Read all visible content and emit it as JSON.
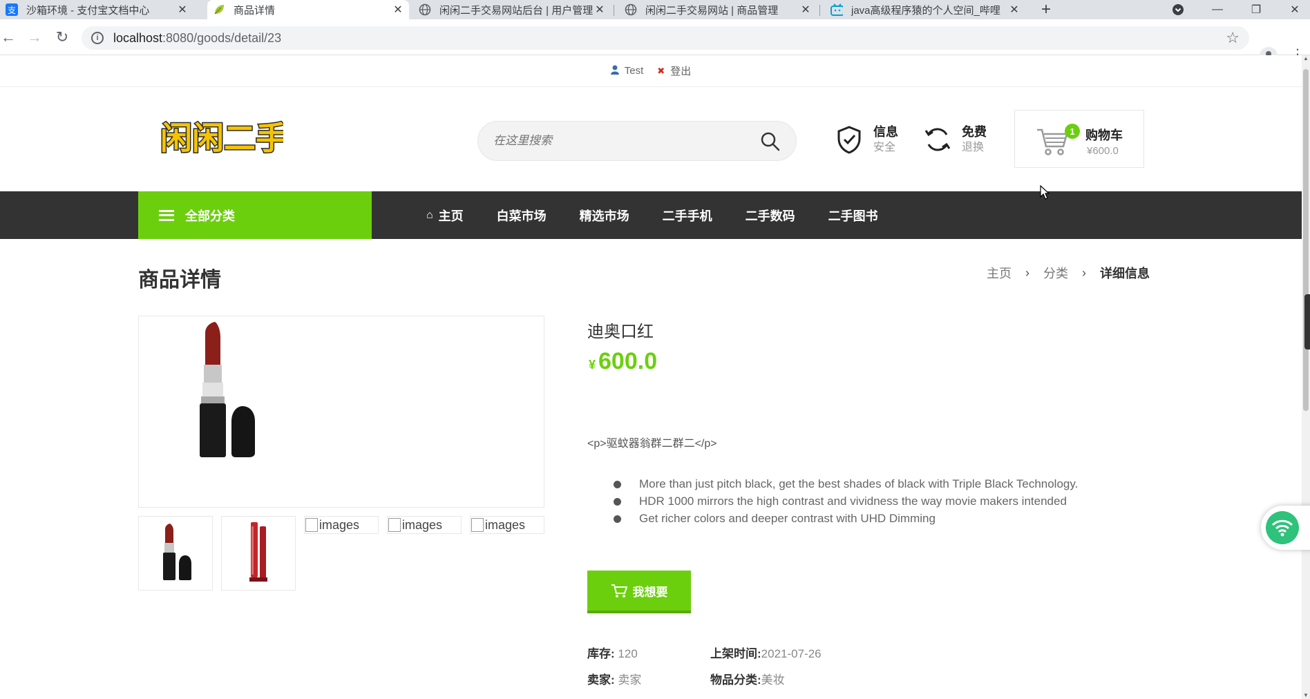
{
  "browser": {
    "tabs": [
      {
        "title": "沙箱环境 - 支付宝文档中心",
        "icon": "alipay-icon"
      },
      {
        "title": "商品详情",
        "icon": "leaf-icon"
      },
      {
        "title": "闲闲二手交易网站后台 | 用户管理",
        "icon": "globe-icon"
      },
      {
        "title": "闲闲二手交易网站 | 商品管理",
        "icon": "globe-icon"
      },
      {
        "title": "java高级程序猿的个人空间_哔哩",
        "icon": "bilibili-icon"
      }
    ],
    "active_tab": 1,
    "url_host": "localhost",
    "url_path": ":8080/goods/detail/23"
  },
  "topbar": {
    "user": "Test",
    "logout": "登出"
  },
  "header": {
    "logo_text": "闲闲二手",
    "search_placeholder": "在这里搜索",
    "features": [
      {
        "title": "信息",
        "sub": "安全",
        "icon": "shield-check-icon"
      },
      {
        "title": "免费",
        "sub": "退换",
        "icon": "refresh-icon"
      }
    ],
    "cart": {
      "label": "购物车",
      "price": "¥600.0",
      "count": "1"
    }
  },
  "nav": {
    "all_categories": "全部分类",
    "items": [
      "主页",
      "白菜市场",
      "精选市场",
      "二手手机",
      "二手数码",
      "二手图书"
    ]
  },
  "page": {
    "title": "商品详情",
    "breadcrumb": [
      "主页",
      "分类",
      "详细信息"
    ]
  },
  "product": {
    "name": "迪奥口红",
    "currency": "¥",
    "price": "600.0",
    "description_raw": "<p>驱蚊器翁群二群二</p>",
    "bullets": [
      "More than just pitch black, get the best shades of black with Triple Black Technology.",
      "HDR 1000 mirrors the high contrast and vividness the way movie makers intended",
      "Get richer colors and deeper contrast with UHD Dimming"
    ],
    "broken_image_alt": "images",
    "want_button": "我想要",
    "meta": {
      "stock_label": "库存:",
      "stock_value": "120",
      "listed_label": "上架时间:",
      "listed_value": "2021-07-26",
      "seller_label": "卖家:",
      "seller_value": "卖家",
      "category_label": "物品分类:",
      "category_value": "美妆"
    }
  },
  "colors": {
    "accent": "#6ccf0e",
    "nav_bg": "#333333"
  }
}
